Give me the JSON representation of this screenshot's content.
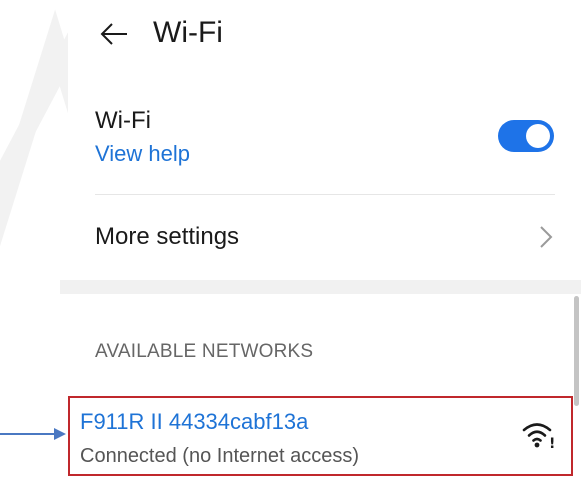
{
  "header": {
    "title": "Wi-Fi",
    "back_icon": "arrow-left-icon"
  },
  "wifi_row": {
    "label": "Wi-Fi",
    "help_link": "View help",
    "toggle_on": true,
    "toggle_color": "#1e73e8"
  },
  "more_settings": {
    "label": "More settings",
    "chevron_icon": "chevron-right-icon"
  },
  "available_networks": {
    "header": "AVAILABLE NETWORKS",
    "items": [
      {
        "name": "F911R II 44334cabf13a",
        "status": "Connected (no Internet access)",
        "signal_icon": "wifi-no-internet-icon"
      }
    ]
  },
  "annotation": {
    "highlight_color": "#c0282c",
    "arrow_color": "#4a78c2"
  }
}
